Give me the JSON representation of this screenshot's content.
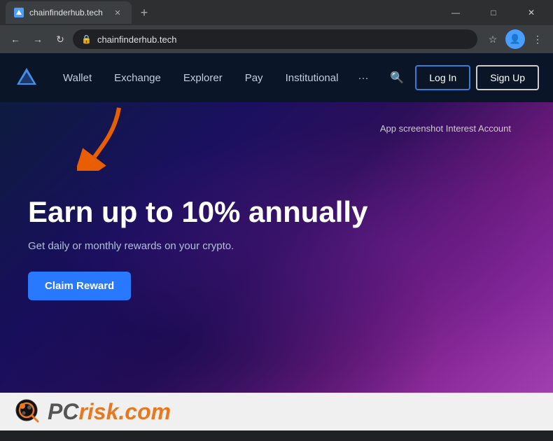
{
  "browser": {
    "tab_title": "chainfinderhub.tech",
    "url": "chainfinderhub.tech",
    "favicon_color": "#4a9eff"
  },
  "navbar": {
    "logo_alt": "ChainFinderHub Logo",
    "links": [
      {
        "label": "Wallet",
        "id": "wallet"
      },
      {
        "label": "Exchange",
        "id": "exchange"
      },
      {
        "label": "Explorer",
        "id": "explorer"
      },
      {
        "label": "Pay",
        "id": "pay"
      },
      {
        "label": "Institutional",
        "id": "institutional"
      }
    ],
    "more_label": "···",
    "login_label": "Log In",
    "signup_label": "Sign Up"
  },
  "hero": {
    "app_screenshot_text": "App screenshot Interest Account",
    "title": "Earn up to 10% annually",
    "subtitle": "Get daily or monthly rewards on your crypto.",
    "cta_label": "Claim Reward"
  },
  "footer": {
    "brand": "PC",
    "brand_suffix": "risk",
    "domain": ".com"
  },
  "window_controls": {
    "minimize": "—",
    "maximize": "□",
    "close": "✕"
  }
}
